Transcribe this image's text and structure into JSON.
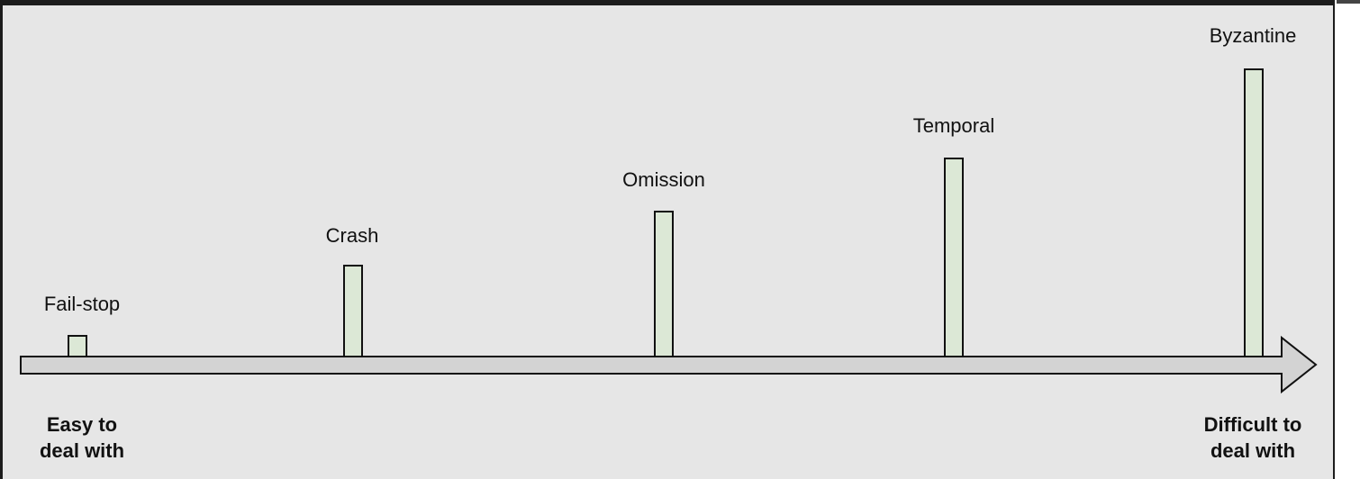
{
  "failure_models": [
    {
      "id": "fail-stop",
      "label": "Fail-stop"
    },
    {
      "id": "crash",
      "label": "Crash"
    },
    {
      "id": "omission",
      "label": "Omission"
    },
    {
      "id": "temporal",
      "label": "Temporal"
    },
    {
      "id": "byzantine",
      "label": "Byzantine"
    }
  ],
  "scale": {
    "left_line1": "Easy to",
    "left_line2": "deal with",
    "right_line1": "Difficult to",
    "right_line2": "deal with"
  },
  "colors": {
    "background": "#e6e6e6",
    "bar_fill": "#dce8d6",
    "arrow_fill": "#d3d3d3",
    "stroke": "#111111"
  }
}
